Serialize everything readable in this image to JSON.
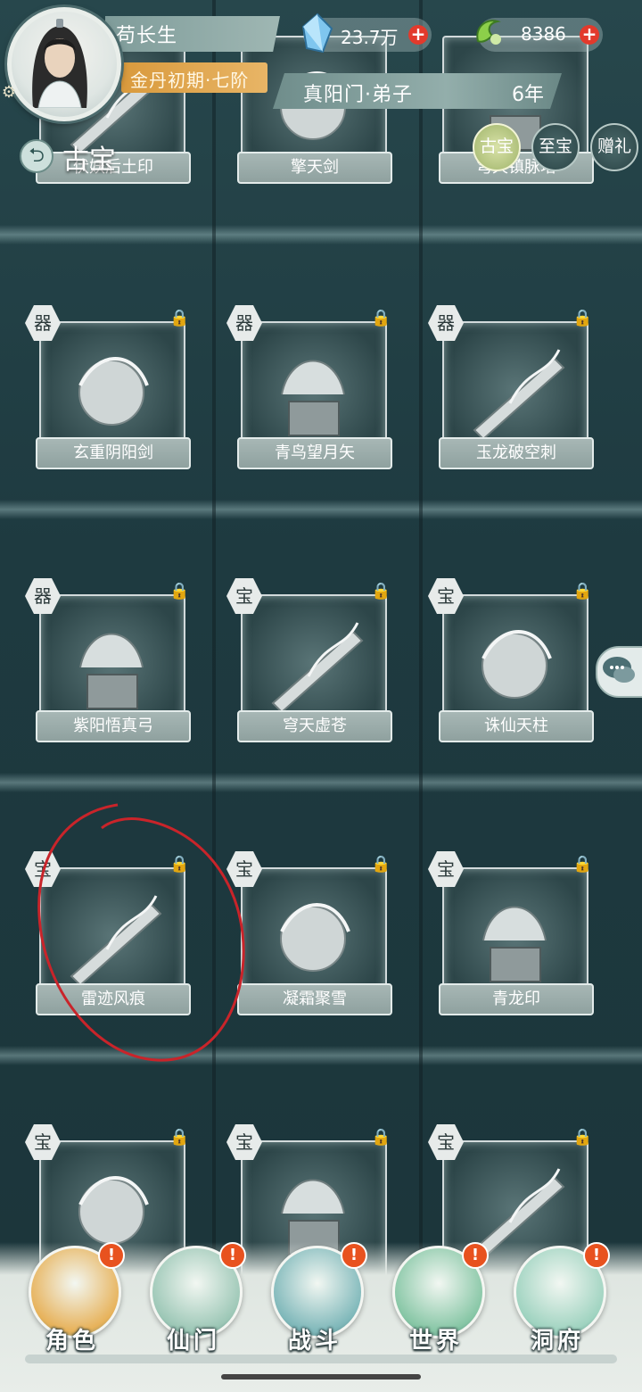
{
  "player": {
    "name": "苟长生",
    "realm": "金丹初期·七阶",
    "sect": "真阳门·弟子",
    "years": "6年"
  },
  "resources": {
    "crystal": "23.7万",
    "jade": "8386"
  },
  "page": {
    "title": "古宝",
    "back_icon": "back-arrow-icon"
  },
  "tabs": [
    {
      "label": "古宝",
      "active": true
    },
    {
      "label": "至宝",
      "active": false
    },
    {
      "label": "赠礼",
      "active": false
    }
  ],
  "rows": [
    [
      {
        "name": "伏妖后土印",
        "badge": "",
        "locked": false
      },
      {
        "name": "擎天剑",
        "badge": "",
        "locked": false
      },
      {
        "name": "穹天镇脉塔",
        "badge": "",
        "locked": false
      }
    ],
    [
      {
        "name": "玄重阴阳剑",
        "badge": "器",
        "locked": true
      },
      {
        "name": "青鸟望月矢",
        "badge": "器",
        "locked": true
      },
      {
        "name": "玉龙破空刺",
        "badge": "器",
        "locked": true
      }
    ],
    [
      {
        "name": "紫阳悟真弓",
        "badge": "器",
        "locked": true
      },
      {
        "name": "穹天虚苍",
        "badge": "宝",
        "locked": true
      },
      {
        "name": "诛仙天柱",
        "badge": "宝",
        "locked": true
      }
    ],
    [
      {
        "name": "雷迹风痕",
        "badge": "宝",
        "locked": true
      },
      {
        "name": "凝霜聚雪",
        "badge": "宝",
        "locked": true
      },
      {
        "name": "青龙印",
        "badge": "宝",
        "locked": true
      }
    ],
    [
      {
        "name": "",
        "badge": "宝",
        "locked": true
      },
      {
        "name": "",
        "badge": "宝",
        "locked": true
      },
      {
        "name": "",
        "badge": "宝",
        "locked": true
      }
    ]
  ],
  "nav": [
    {
      "label": "角色",
      "alert": "!",
      "color": "#e7b25a"
    },
    {
      "label": "仙门",
      "alert": "!",
      "color": "#9cc7b6"
    },
    {
      "label": "战斗",
      "alert": "!",
      "color": "#7fb8ba"
    },
    {
      "label": "世界",
      "alert": "!",
      "color": "#86c6a5"
    },
    {
      "label": "洞府",
      "alert": "!",
      "color": "#9fd3c0"
    }
  ],
  "colors": {
    "background": "#1f3a3f",
    "accent_gold": "#d99a3d",
    "alert_red": "#e8521f"
  }
}
